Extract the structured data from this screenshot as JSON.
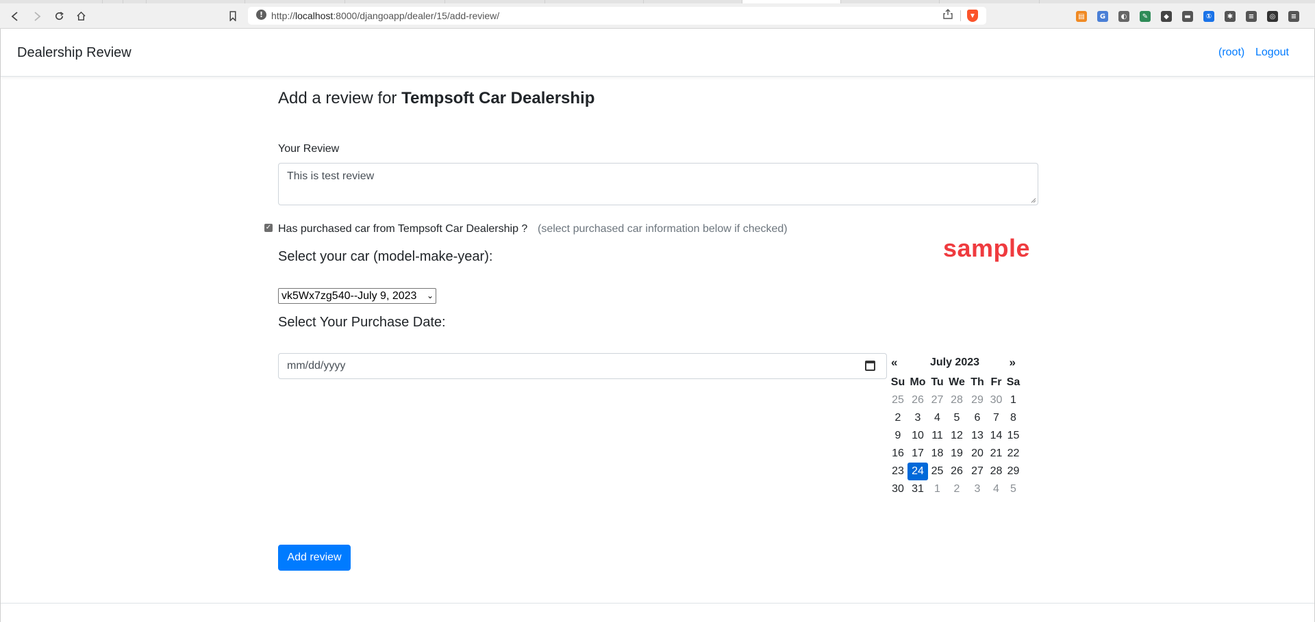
{
  "browser": {
    "url_prefix": "http://",
    "url_host": "localhost",
    "url_rest": ":8000/djangoapp/dealer/15/add-review/",
    "icons": {
      "back": "back-arrow-icon",
      "forward": "forward-arrow-icon",
      "reload": "reload-icon",
      "home": "home-icon",
      "bookmark": "bookmark-icon",
      "site_info": "info-icon",
      "share": "share-icon",
      "shield": "brave-shield-icon"
    },
    "info_glyph": "!",
    "brave_glyph": "▼",
    "extensions": [
      {
        "name": "extension-orange-icon",
        "color": "#f08a24",
        "glyph": "▤"
      },
      {
        "name": "extension-translate-icon",
        "color": "#4a7fd6",
        "glyph": "G"
      },
      {
        "name": "extension-privacy-icon",
        "color": "#666666",
        "glyph": "◐"
      },
      {
        "name": "extension-pen-icon",
        "color": "#2e8b57",
        "glyph": "✎"
      },
      {
        "name": "extension-cube-icon",
        "color": "#444444",
        "glyph": "◆"
      },
      {
        "name": "extension-card-icon",
        "color": "#555555",
        "glyph": "▬"
      },
      {
        "name": "extension-password-icon",
        "color": "#1a73e8",
        "glyph": "①"
      },
      {
        "name": "extensions-puzzle-icon",
        "color": "#555555",
        "glyph": "✱"
      },
      {
        "name": "reading-list-icon",
        "color": "#555555",
        "glyph": "≡"
      },
      {
        "name": "profile-icon",
        "color": "#333333",
        "glyph": "◎"
      },
      {
        "name": "menu-icon",
        "color": "#555555",
        "glyph": "≡"
      }
    ]
  },
  "navbar": {
    "brand": "Dealership Review",
    "user_link": "(root)",
    "logout_link": "Logout"
  },
  "form": {
    "heading_prefix": "Add a review for ",
    "dealer_name": "Tempsoft Car Dealership",
    "review_label": "Your Review",
    "review_value": "This is test review",
    "purchase_checked": true,
    "purchase_label": "Has purchased car from Tempsoft Car Dealership ?",
    "purchase_hint": "(select purchased car information below if checked)",
    "car_heading": "Select your car (model-make-year):",
    "car_selected": "vk5Wx7zg540--July 9, 2023",
    "date_heading": "Select Your Purchase Date:",
    "date_placeholder": "mm/dd/yyyy",
    "submit_label": "Add review"
  },
  "watermark": "sample",
  "calendar": {
    "title": "July 2023",
    "prev": "«",
    "next": "»",
    "weekdays": [
      "Su",
      "Mo",
      "Tu",
      "We",
      "Th",
      "Fr",
      "Sa"
    ],
    "selected_day": "24",
    "days": [
      {
        "d": "25",
        "m": true
      },
      {
        "d": "26",
        "m": true
      },
      {
        "d": "27",
        "m": true
      },
      {
        "d": "28",
        "m": true
      },
      {
        "d": "29",
        "m": true
      },
      {
        "d": "30",
        "m": true
      },
      {
        "d": "1",
        "m": false
      },
      {
        "d": "2",
        "m": false
      },
      {
        "d": "3",
        "m": false
      },
      {
        "d": "4",
        "m": false
      },
      {
        "d": "5",
        "m": false
      },
      {
        "d": "6",
        "m": false
      },
      {
        "d": "7",
        "m": false
      },
      {
        "d": "8",
        "m": false
      },
      {
        "d": "9",
        "m": false
      },
      {
        "d": "10",
        "m": false
      },
      {
        "d": "11",
        "m": false
      },
      {
        "d": "12",
        "m": false
      },
      {
        "d": "13",
        "m": false
      },
      {
        "d": "14",
        "m": false
      },
      {
        "d": "15",
        "m": false
      },
      {
        "d": "16",
        "m": false
      },
      {
        "d": "17",
        "m": false
      },
      {
        "d": "18",
        "m": false
      },
      {
        "d": "19",
        "m": false
      },
      {
        "d": "20",
        "m": false
      },
      {
        "d": "21",
        "m": false
      },
      {
        "d": "22",
        "m": false
      },
      {
        "d": "23",
        "m": false
      },
      {
        "d": "24",
        "m": false
      },
      {
        "d": "25",
        "m": false
      },
      {
        "d": "26",
        "m": false
      },
      {
        "d": "27",
        "m": false
      },
      {
        "d": "28",
        "m": false
      },
      {
        "d": "29",
        "m": false
      },
      {
        "d": "30",
        "m": false
      },
      {
        "d": "31",
        "m": false
      },
      {
        "d": "1",
        "m": true
      },
      {
        "d": "2",
        "m": true
      },
      {
        "d": "3",
        "m": true
      },
      {
        "d": "4",
        "m": true
      },
      {
        "d": "5",
        "m": true
      }
    ]
  },
  "colors": {
    "link": "#007bff",
    "primary_button": "#007bff",
    "selected_day": "#0069d9",
    "watermark": "#ef3b3f"
  }
}
